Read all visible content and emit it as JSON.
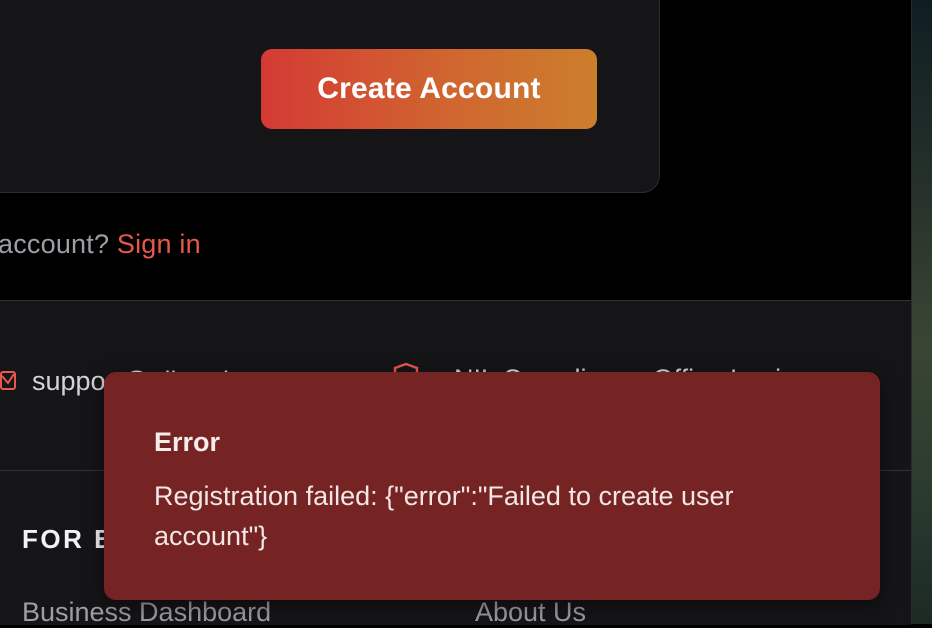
{
  "signup_card": {
    "create_button_label": "Create Account"
  },
  "signin_prompt": {
    "text": "account? ",
    "link_label": "Sign in"
  },
  "footer": {
    "email_text": "support@nilmarket.com",
    "compliance_text": "NIL Compliance  Office Login",
    "section_heading": "FOR BUSINESSES",
    "links": [
      "Business Dashboard",
      "About Us"
    ]
  },
  "toast": {
    "title": "Error",
    "message": "Registration failed: {\"error\":\"Failed to create user account\"}"
  },
  "colors": {
    "accent": "#e8574f",
    "button_gradient_start": "#d43a34",
    "button_gradient_end": "#cb7e2c",
    "toast_background": "#752423",
    "page_background": "#000000",
    "panel_background": "#151517"
  },
  "icons": [
    "mail-icon",
    "shield-icon"
  ]
}
